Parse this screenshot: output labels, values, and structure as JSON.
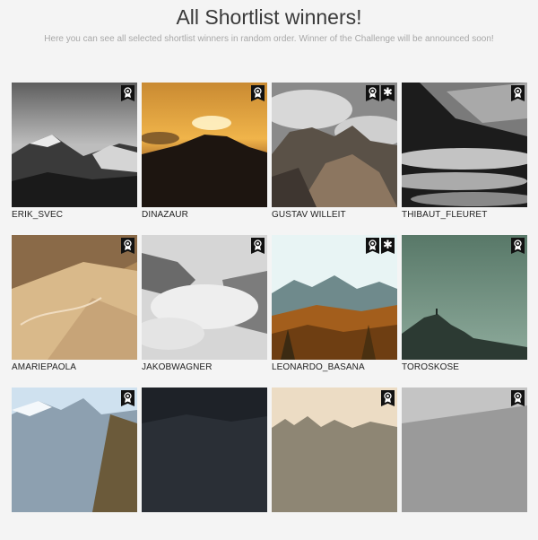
{
  "header": {
    "title": "All Shortlist winners!",
    "subtitle": "Here you can see all selected shortlist winners in random order. Winner of the Challenge will be announced soon!"
  },
  "entries": [
    {
      "name": "ERIK_SVEC",
      "badges": [
        "ribbon-icon"
      ]
    },
    {
      "name": "DINAZAUR",
      "badges": [
        "ribbon-icon"
      ]
    },
    {
      "name": "GUSTAV WILLEIT",
      "badges": [
        "ribbon-icon",
        "asterisk-icon"
      ]
    },
    {
      "name": "THIBAUT_FLEURET",
      "badges": [
        "ribbon-icon"
      ]
    },
    {
      "name": "AMARIEPAOLA",
      "badges": [
        "ribbon-icon"
      ]
    },
    {
      "name": "JAKOBWAGNER",
      "badges": [
        "ribbon-icon"
      ]
    },
    {
      "name": "LEONARDO_BASANA",
      "badges": [
        "ribbon-icon",
        "asterisk-icon"
      ]
    },
    {
      "name": "TOROSKOSE",
      "badges": [
        "ribbon-icon"
      ]
    },
    {
      "name": "",
      "badges": [
        "ribbon-icon"
      ]
    },
    {
      "name": "",
      "badges": []
    },
    {
      "name": "",
      "badges": [
        "ribbon-icon"
      ]
    },
    {
      "name": "",
      "badges": [
        "ribbon-icon"
      ]
    }
  ],
  "asterisk_glyph": "✱",
  "colors": {
    "background": "#f4f4f4",
    "badge": "#111111",
    "title": "#3a3a3a",
    "subtitle": "#a8a8a8"
  }
}
